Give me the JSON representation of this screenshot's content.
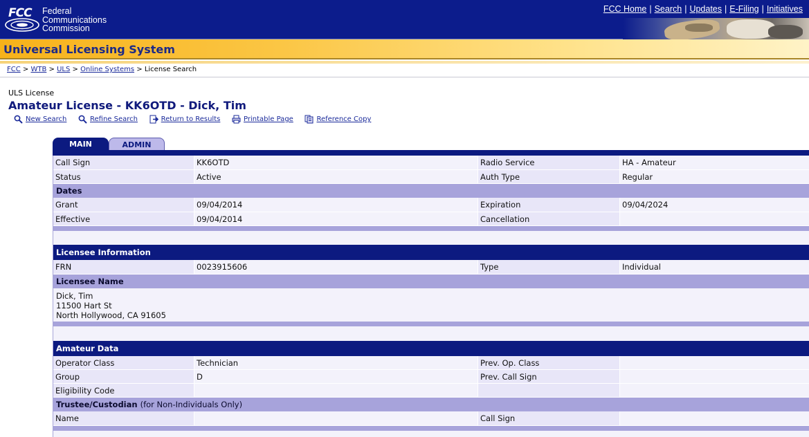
{
  "header": {
    "logo_fcc": "FCC",
    "logo_lines": [
      "Federal",
      "Communications",
      "Commission"
    ],
    "links": [
      "FCC Home",
      "Search",
      "Updates",
      "E-Filing",
      "Initiatives"
    ],
    "separator": "|"
  },
  "banner": {
    "title": "Universal Licensing System"
  },
  "breadcrumb": {
    "items": [
      "FCC",
      "WTB",
      "ULS",
      "Online Systems",
      "License Search"
    ],
    "separator": ">"
  },
  "page": {
    "label": "ULS License",
    "title": "Amateur License - KK6OTD - Dick, Tim"
  },
  "actions": [
    {
      "label": "New Search",
      "icon": "magnifier-icon"
    },
    {
      "label": "Refine Search",
      "icon": "magnifier-icon"
    },
    {
      "label": "Return to Results",
      "icon": "arrow-page-icon"
    },
    {
      "label": "Printable Page",
      "icon": "printer-icon"
    },
    {
      "label": "Reference Copy",
      "icon": "document-copy-icon"
    }
  ],
  "tabs": {
    "main": "MAIN",
    "admin": "ADMIN"
  },
  "license": {
    "call_sign_label": "Call Sign",
    "call_sign": "KK6OTD",
    "radio_service_label": "Radio Service",
    "radio_service": "HA - Amateur",
    "status_label": "Status",
    "status": "Active",
    "auth_type_label": "Auth Type",
    "auth_type": "Regular",
    "dates_heading": "Dates",
    "grant_label": "Grant",
    "grant": "09/04/2014",
    "expiration_label": "Expiration",
    "expiration": "09/04/2024",
    "effective_label": "Effective",
    "effective": "09/04/2014",
    "cancellation_label": "Cancellation",
    "cancellation": ""
  },
  "licensee": {
    "heading": "Licensee Information",
    "frn_label": "FRN",
    "frn": "0023915606",
    "type_label": "Type",
    "type": "Individual",
    "name_heading": "Licensee Name",
    "address_lines": [
      "Dick, Tim",
      "11500 Hart St",
      "North Hollywood, CA 91605"
    ]
  },
  "amateur": {
    "heading": "Amateur Data",
    "operator_class_label": "Operator Class",
    "operator_class": "Technician",
    "prev_op_class_label": "Prev. Op. Class",
    "prev_op_class": "",
    "group_label": "Group",
    "group": "D",
    "prev_call_sign_label": "Prev. Call Sign",
    "prev_call_sign": "",
    "eligibility_label": "Eligibility Code",
    "eligibility": "",
    "trustee_heading": "Trustee/Custodian",
    "trustee_note": "(for Non-Individuals Only)",
    "name_label": "Name",
    "name": "",
    "trustee_call_sign_label": "Call Sign",
    "trustee_call_sign": ""
  },
  "colors": {
    "header_blue": "#0c1c8c",
    "banner_gold": "#f7b21a",
    "section_purple": "#a7a3db",
    "cell_light": "#f3f2fb"
  }
}
